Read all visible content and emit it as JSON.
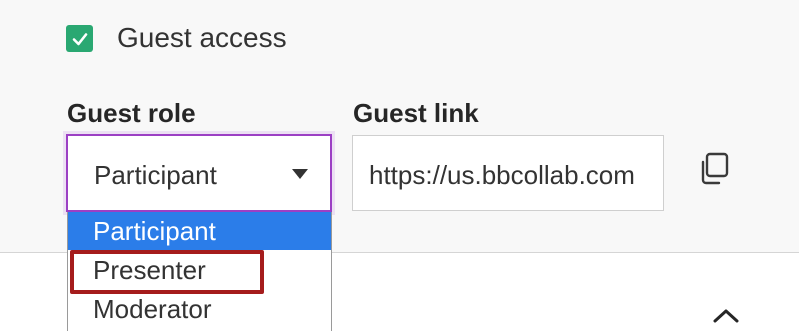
{
  "guest_access": {
    "label": "Guest access",
    "checked": true,
    "color": "#2aa872"
  },
  "guest_role": {
    "label": "Guest role",
    "selected": "Participant",
    "options": [
      "Participant",
      "Presenter",
      "Moderator"
    ],
    "highlighted_option": "Presenter"
  },
  "guest_link": {
    "label": "Guest link",
    "value": "https://us.bbcollab.com"
  },
  "icons": {
    "copy": "copy-icon",
    "collapse": "chevron-up-icon",
    "checkmark": "checkmark-icon",
    "caret": "caret-down-icon"
  },
  "colors": {
    "accent": "#9c3fc4",
    "selection": "#2b7de9",
    "annotation": "#a51c1c"
  }
}
